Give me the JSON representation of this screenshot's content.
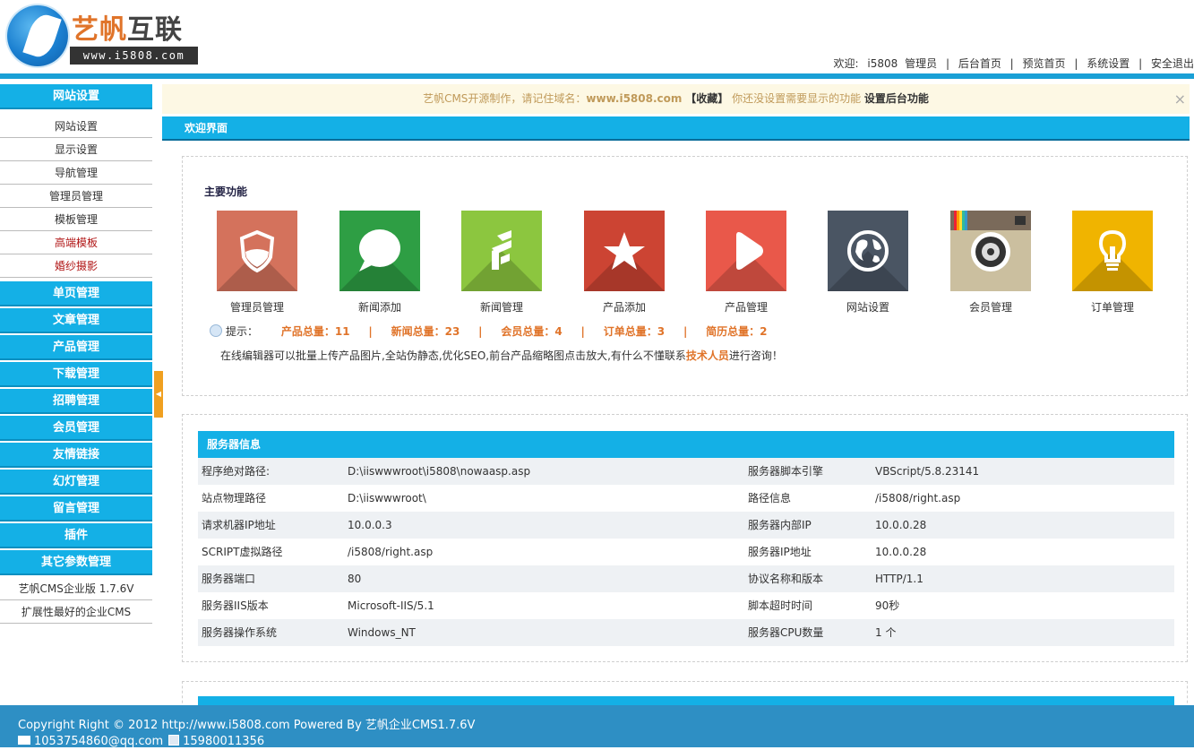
{
  "brand": {
    "name_part1": "艺帆",
    "name_part2": "互联",
    "url": "www.i5808.com"
  },
  "topnav": {
    "welcome": "欢迎:",
    "user": "i5808",
    "role": "管理员",
    "links": [
      "后台首页",
      "预览首页",
      "系统设置",
      "安全退出"
    ]
  },
  "sidebar": {
    "groups": [
      {
        "label": "网站设置",
        "items": [
          {
            "label": "网站设置"
          },
          {
            "label": "显示设置"
          },
          {
            "label": "导航管理"
          },
          {
            "label": "管理员管理"
          },
          {
            "label": "模板管理"
          },
          {
            "label": "高端模板"
          },
          {
            "label": "婚纱摄影"
          }
        ]
      },
      {
        "label": "单页管理"
      },
      {
        "label": "文章管理"
      },
      {
        "label": "产品管理"
      },
      {
        "label": "下载管理"
      },
      {
        "label": "招聘管理"
      },
      {
        "label": "会员管理"
      },
      {
        "label": "友情链接"
      },
      {
        "label": "幻灯管理"
      },
      {
        "label": "留言管理"
      },
      {
        "label": "插件"
      },
      {
        "label": "其它参数管理"
      }
    ],
    "footer_items": [
      "艺帆CMS企业版 1.7.6V",
      "扩展性最好的企业CMS"
    ]
  },
  "notice": {
    "text1": "艺帆CMS开源制作，请记住域名：",
    "domain": "www.i5808.com",
    "bookmark": "【收藏】",
    "text2": "你还没设置需要显示的功能",
    "action": "设置后台功能",
    "close": "×"
  },
  "welcome_title": "欢迎界面",
  "main_functions": {
    "title": "主要功能",
    "tiles": [
      {
        "label": "管理员管理",
        "color": "#d4725c",
        "icon": "shield-icon"
      },
      {
        "label": "新闻添加",
        "color": "#2e9e44",
        "icon": "chat-bubble-icon"
      },
      {
        "label": "新闻管理",
        "color": "#8cc63f",
        "icon": "feed-icon"
      },
      {
        "label": "产品添加",
        "color": "#cc4433",
        "icon": "star-icon"
      },
      {
        "label": "产品管理",
        "color": "#e9584a",
        "icon": "play-icon"
      },
      {
        "label": "网站设置",
        "color": "#4a5563",
        "icon": "globe-icon"
      },
      {
        "label": "会员管理",
        "color": "#cbbf9f",
        "icon": "camera-icon"
      },
      {
        "label": "订单管理",
        "color": "#f0b400",
        "icon": "lightbulb-icon"
      }
    ],
    "tip_label": "提示：",
    "stats": [
      "产品总量：11",
      "新闻总量：23",
      "会员总量：4",
      "订单总量：3",
      "简历总量：2"
    ],
    "separator": "|",
    "desc_text": "在线编辑器可以批量上传产品图片,全站伪静态,优化SEO,前台产品缩略图点击放大,有什么不懂联系",
    "desc_link": "技术人员",
    "desc_tail": "进行咨询！"
  },
  "server_info": {
    "title": "服务器信息",
    "rows": [
      {
        "k1": "程序绝对路径:",
        "v1": "D:\\iiswwwroot\\i5808\\nowaasp.asp",
        "k2": "服务器脚本引擎",
        "v2": "VBScript/5.8.23141"
      },
      {
        "k1": "站点物理路径",
        "v1": "D:\\iiswwwroot\\",
        "k2": "路径信息",
        "v2": "/i5808/right.asp"
      },
      {
        "k1": "请求机器IP地址",
        "v1": "10.0.0.3",
        "k2": "服务器内部IP",
        "v2": "10.0.0.28"
      },
      {
        "k1": "SCRIPT虚拟路径",
        "v1": "/i5808/right.asp",
        "k2": "服务器IP地址",
        "v2": "10.0.0.28"
      },
      {
        "k1": "服务器端口",
        "v1": "80",
        "k2": "协议名称和版本",
        "v2": "HTTP/1.1"
      },
      {
        "k1": "服务器IIS版本",
        "v1": "Microsoft-IIS/5.1",
        "k2": "脚本超时时间",
        "v2": "90秒"
      },
      {
        "k1": "服务器操作系统",
        "v1": "Windows_NT",
        "k2": "服务器CPU数量",
        "v2": "1 个"
      }
    ]
  },
  "footer": {
    "copyright": "Copyright Right © 2012 http://www.i5808.com Powered By 艺帆企业CMS1.7.6V",
    "email": "1053754860@qq.com",
    "phone": "15980011356"
  }
}
